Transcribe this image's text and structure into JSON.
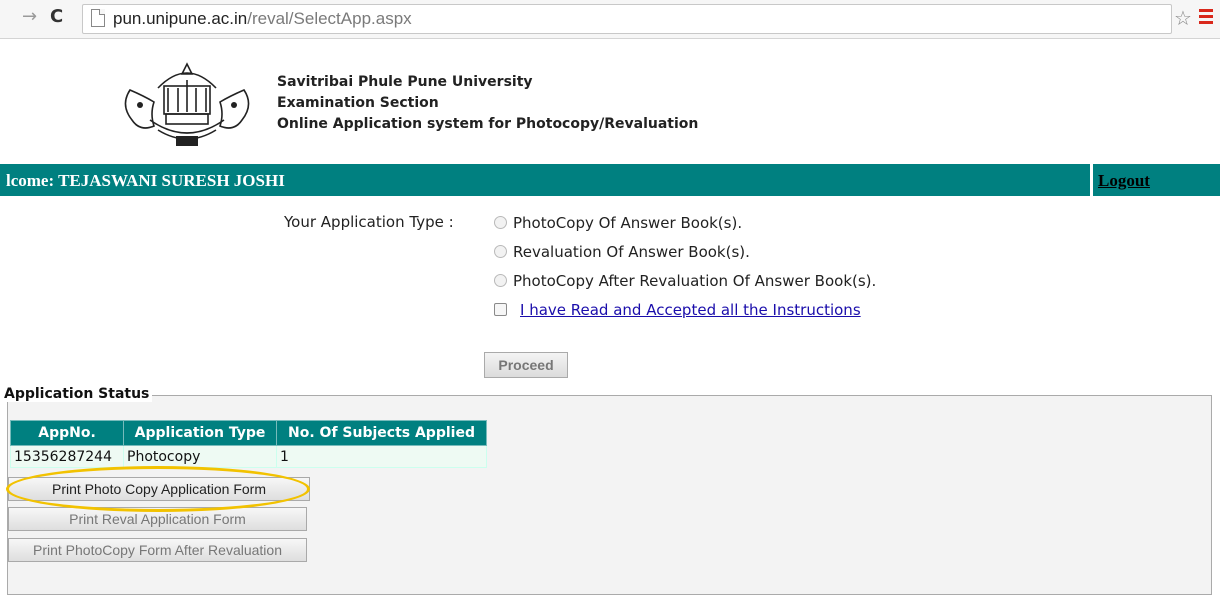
{
  "browser": {
    "url_host": "pun.unipune.ac.in",
    "url_path": "/reval/SelectApp.aspx"
  },
  "header": {
    "line1": "Savitribai Phule Pune University",
    "line2": "Examination Section",
    "line3": "Online Application system for Photocopy/Revaluation"
  },
  "welcome_bar": {
    "text": "lcome: TEJASWANI SURESH JOSHI",
    "logout": "Logout"
  },
  "application_type": {
    "label": "Your Application Type :",
    "options": [
      "PhotoCopy Of Answer Book(s).",
      "Revaluation Of Answer Book(s).",
      "PhotoCopy After Revaluation Of Answer Book(s)."
    ],
    "instructions_link": "I have Read and Accepted all the Instructions",
    "proceed": "Proceed"
  },
  "status": {
    "legend": "Application Status",
    "columns": [
      "AppNo.",
      "Application Type",
      "No. Of Subjects Applied"
    ],
    "rows": [
      [
        "15356287244",
        "Photocopy",
        "1"
      ]
    ]
  },
  "buttons": {
    "print_photocopy": "Print Photo Copy Application Form",
    "print_reval": "Print Reval Application Form",
    "print_after_reval": "Print PhotoCopy Form After Revaluation"
  },
  "colors": {
    "accent_teal": "#008080",
    "highlight": "#f2c200"
  }
}
